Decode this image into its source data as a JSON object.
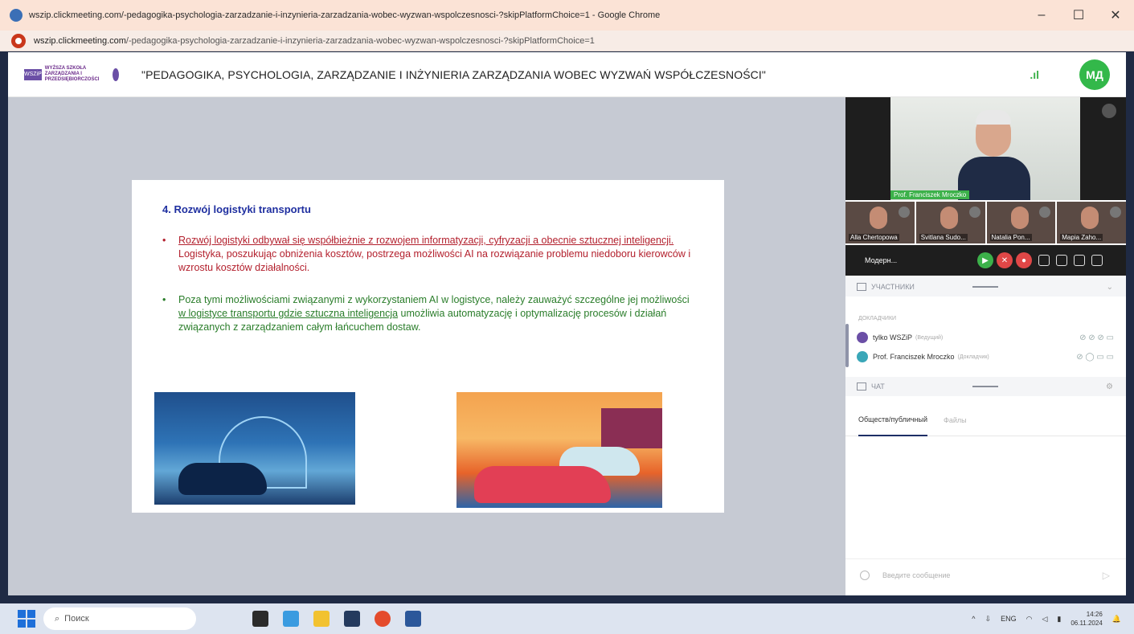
{
  "browser": {
    "window_title": "wszip.clickmeeting.com/-pedagogika-psychologia-zarzadzanie-i-inzynieria-zarzadzania-wobec-wyzwan-wspolczesnosci-?skipPlatformChoice=1 - Google Chrome",
    "url_host": "wszip.clickmeeting.com",
    "url_path": "/-pedagogika-psychologia-zarzadzanie-i-inzynieria-zarzadzania-wobec-wyzwan-wspolczesnosci-?skipPlatformChoice=1",
    "minimize": "–",
    "maximize": "☐",
    "close": "✕"
  },
  "header": {
    "logo_mark": "WSZiP",
    "logo_text": "WYŻSZA SZKOŁA ZARZĄDZANIA I PRZEDSIĘBIORCZOŚCI",
    "event_title": "\"PEDAGOGIKA, PSYCHOLOGIA, ZARZĄDZANIE I INŻYNIERIA ZARZĄDZANIA WOBEC WYZWAŃ WSPÓŁCZESNOŚCI\"",
    "signal_icon": "signal-bars-icon",
    "avatar_initials": "МД",
    "avatar_color": "#33b84a"
  },
  "slide": {
    "heading": "4. Rozwój logistyki transportu",
    "bullet1_underlined": "Rozwój logistyki odbywał się współbieżnie z rozwojem informatyzacji, cyfryzacji a obecnie sztucznej inteligencji.",
    "bullet1_rest": " Logistyka, poszukując obniżenia kosztów, postrzega możliwości AI na rozwiązanie problemu niedoboru kierowców i wzrostu kosztów działalności.",
    "bullet2_start": "Poza tymi możliwościami związanymi z wykorzystaniem AI w logistyce, należy zauważyć szczególne jej możliwości ",
    "bullet2_underlined": "w logistyce transportu gdzie sztuczna inteligencja",
    "bullet2_end": " umożliwia automatyzację i optymalizację procesów i działań związanych z zarządzaniem całym łańcuchem dostaw.",
    "bullet_mark": "•",
    "heading_color": "#1f2fa0",
    "bullet1_color": "#b3202d",
    "bullet2_color": "#2a7d2a"
  },
  "video": {
    "speaker_name": "Prof. Franciszek Mroczko",
    "participants": [
      {
        "name": "Alla Chertopowa"
      },
      {
        "name": "Svitlana Sudo..."
      },
      {
        "name": "Natalia Pon..."
      },
      {
        "name": "Mapia Zaho..."
      }
    ],
    "mode_label": "Модерн..."
  },
  "participants_panel": {
    "title": "УЧАСТНИКИ",
    "group_label": "ДОКЛАДЧИКИ",
    "rows": [
      {
        "name": "tylko WSZiP",
        "role": "(Ведущий)",
        "color": "#6b4fa6"
      },
      {
        "name": "Prof. Franciszek Mroczko",
        "role": "(Докладчик)",
        "color": "#3aa7b8"
      }
    ]
  },
  "chat_panel": {
    "title": "ЧАТ",
    "tabs": [
      {
        "label": "Обществ/публичный"
      },
      {
        "label": "Файлы"
      }
    ],
    "input_placeholder": "Введите сообщение",
    "send_icon": "send-icon"
  },
  "taskbar": {
    "search_placeholder": "Поиск",
    "lang": "ENG",
    "time": "14:26",
    "date": "06.11.2024"
  }
}
